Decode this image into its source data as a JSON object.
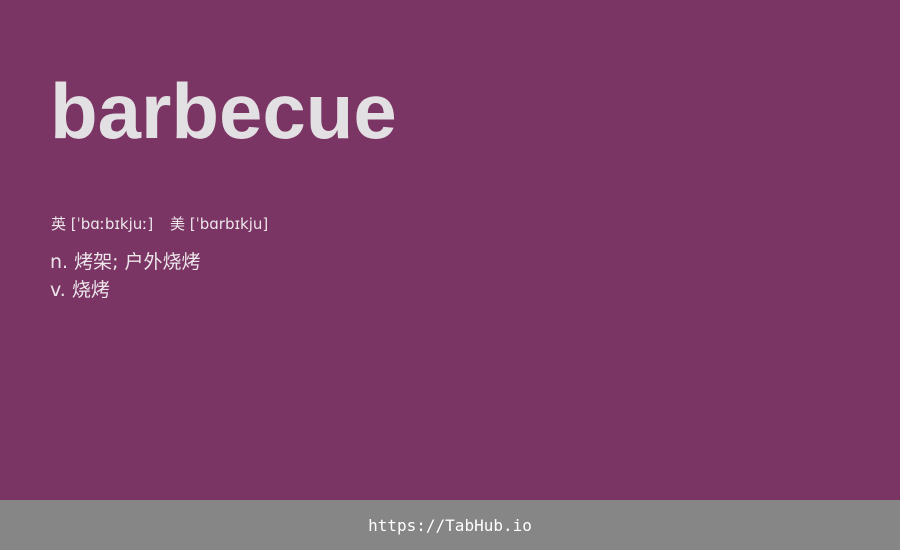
{
  "word": "barbecue",
  "phonetics": {
    "uk": "英 [ˈbɑːbɪkjuː]",
    "us": "美 [ˈbɑrbɪkju]"
  },
  "definitions": [
    "n. 烤架; 户外烧烤",
    "v. 烧烤"
  ],
  "footer": {
    "link": "https://TabHub.io"
  }
}
